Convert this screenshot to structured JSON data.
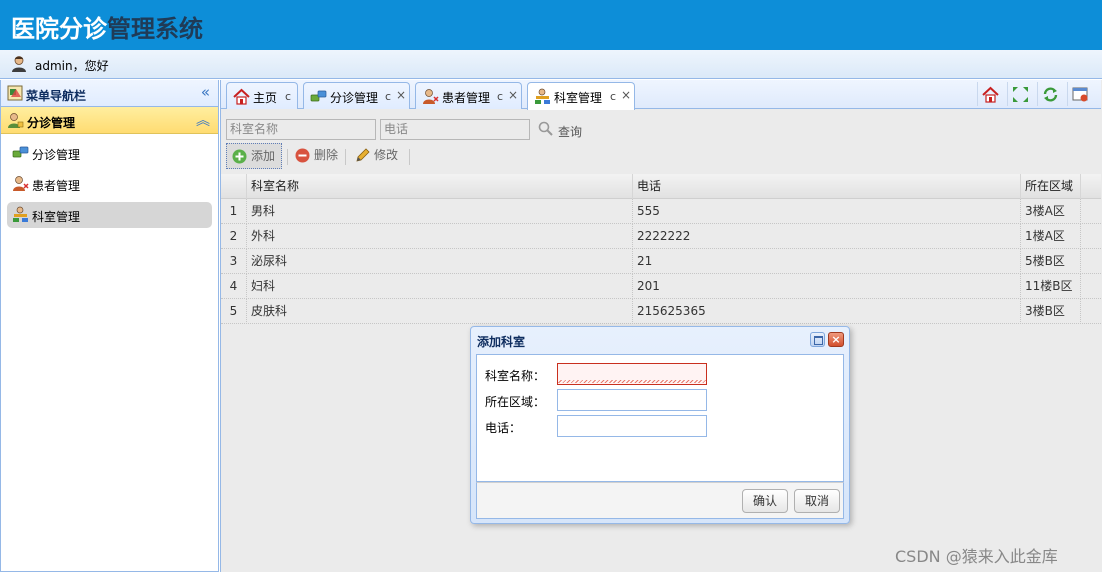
{
  "header": {
    "title_part1": "医院分诊",
    "title_part2": "管理系统"
  },
  "userbar": {
    "greeting": "admin，您好",
    "icon": "user-icon"
  },
  "sidebar": {
    "title": "菜单导航栏",
    "group": {
      "label": "分诊管理"
    },
    "items": [
      {
        "label": "分诊管理",
        "icon": "link-icon",
        "active": false
      },
      {
        "label": "患者管理",
        "icon": "patient-icon",
        "active": false
      },
      {
        "label": "科室管理",
        "icon": "department-icon",
        "active": true
      }
    ]
  },
  "tabs": [
    {
      "label": "主页",
      "refresh": "c"
    },
    {
      "label": "分诊管理",
      "refresh": "c",
      "close": "×"
    },
    {
      "label": "患者管理",
      "refresh": "c",
      "close": "×"
    },
    {
      "label": "科室管理",
      "refresh": "c",
      "close": "×",
      "active": true
    }
  ],
  "search": {
    "name_placeholder": "科室名称",
    "phone_placeholder": "电话",
    "query_label": "查询"
  },
  "toolbar": {
    "add_label": "添加",
    "delete_label": "删除",
    "edit_label": "修改"
  },
  "grid": {
    "columns": [
      "科室名称",
      "电话",
      "所在区域"
    ],
    "rows": [
      {
        "n": "1",
        "name": "男科",
        "phone": "555",
        "area": "3楼A区"
      },
      {
        "n": "2",
        "name": "外科",
        "phone": "2222222",
        "area": "1楼A区"
      },
      {
        "n": "3",
        "name": "泌尿科",
        "phone": "21",
        "area": "5楼B区"
      },
      {
        "n": "4",
        "name": "妇科",
        "phone": "201",
        "area": "11楼B区"
      },
      {
        "n": "5",
        "name": "皮肤科",
        "phone": "215625365",
        "area": "3楼B区"
      }
    ]
  },
  "dialog": {
    "title": "添加科室",
    "fields": [
      {
        "label": "科室名称："
      },
      {
        "label": "所在区域："
      },
      {
        "label": "电话："
      }
    ],
    "confirm_label": "确认",
    "cancel_label": "取消"
  },
  "watermark": "CSDN @猿来入此金库",
  "colors": {
    "header_bg": "#0d8ed8",
    "border": "#95b8e7",
    "group_bg": "#ffdc72"
  }
}
